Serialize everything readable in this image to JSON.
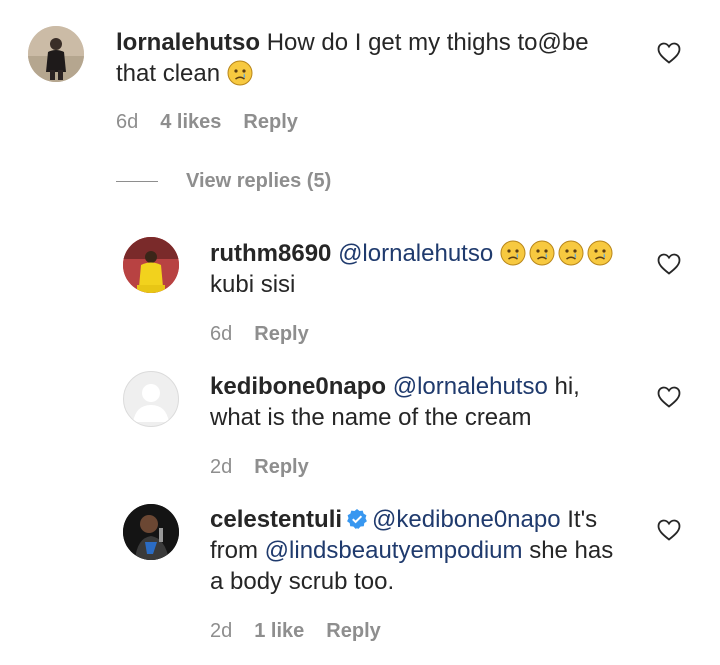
{
  "comments": [
    {
      "username": "lornalehutso",
      "text": "How do I get my thighs to@be that clean",
      "time": "6d",
      "likes": "4 likes",
      "reply": "Reply"
    }
  ],
  "view_replies": "View replies (5)",
  "replies": [
    {
      "username": "ruthm8690",
      "mention": "@lornalehutso",
      "text": "kubi sisi",
      "time": "6d",
      "reply": "Reply"
    },
    {
      "username": "kedibone0napo",
      "mention": "@lornalehutso",
      "text_a": "hi,",
      "text_b": "what is the name of the cream",
      "time": "2d",
      "reply": "Reply"
    },
    {
      "username": "celestentuli",
      "mention": "@kedibone0napo",
      "text_a": "It's",
      "text_b": "from",
      "mention2": "@lindsbeautyempodium",
      "text_c": "she has",
      "text_d": "a body scrub too.",
      "time": "2d",
      "likes": "1 like",
      "reply": "Reply"
    }
  ],
  "icons": {
    "heart": "heart-outline-icon",
    "emoji": "crying-face-emoji",
    "verified": "verified-badge-icon"
  },
  "colors": {
    "text": "#262626",
    "meta": "#8e8e8e",
    "mention": "#1f3a6d",
    "verified": "#3897f0"
  }
}
